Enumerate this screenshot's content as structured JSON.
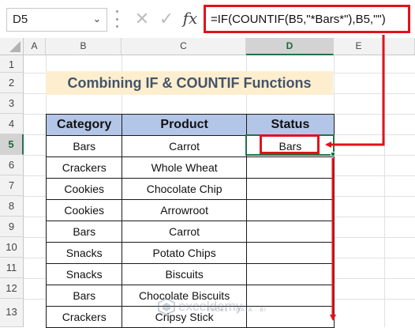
{
  "formula_bar": {
    "name_box": "D5",
    "name_box_caret": "⌄",
    "cancel_icon": "✕",
    "enter_icon": "✓",
    "fx_label": "fx",
    "formula": "=IF(COUNTIF(B5,\"*Bars*\"),B5,\"\")"
  },
  "grid": {
    "columns": [
      "A",
      "B",
      "C",
      "D",
      "E"
    ],
    "selected_column": "D",
    "rows": [
      "1",
      "2",
      "3",
      "4",
      "5",
      "6",
      "7",
      "8",
      "9",
      "10",
      "11",
      "12",
      "13"
    ],
    "selected_row": "5"
  },
  "sheet": {
    "title": "Combining IF & COUNTIF Functions",
    "headers": [
      "Category",
      "Product",
      "Status"
    ],
    "rows": [
      {
        "category": "Bars",
        "product": "Carrot",
        "status": "Bars"
      },
      {
        "category": "Crackers",
        "product": "Whole Wheat",
        "status": ""
      },
      {
        "category": "Cookies",
        "product": "Chocolate Chip",
        "status": ""
      },
      {
        "category": "Cookies",
        "product": "Arrowroot",
        "status": ""
      },
      {
        "category": "Bars",
        "product": "Carrot",
        "status": ""
      },
      {
        "category": "Snacks",
        "product": "Potato Chips",
        "status": ""
      },
      {
        "category": "Snacks",
        "product": "Biscuits",
        "status": ""
      },
      {
        "category": "Bars",
        "product": "Chocolate Biscuits",
        "status": ""
      },
      {
        "category": "Crackers",
        "product": "Cripsy Stick",
        "status": ""
      }
    ]
  },
  "watermark": {
    "name": "exceldemy",
    "tagline": "EXCEL · DATA · BI"
  },
  "colors": {
    "header_fill": "#b4c6e7",
    "title_fill": "#fdeecf",
    "title_text": "#44546a",
    "annotation_red": "#e0121c",
    "selection_green": "#217346"
  }
}
